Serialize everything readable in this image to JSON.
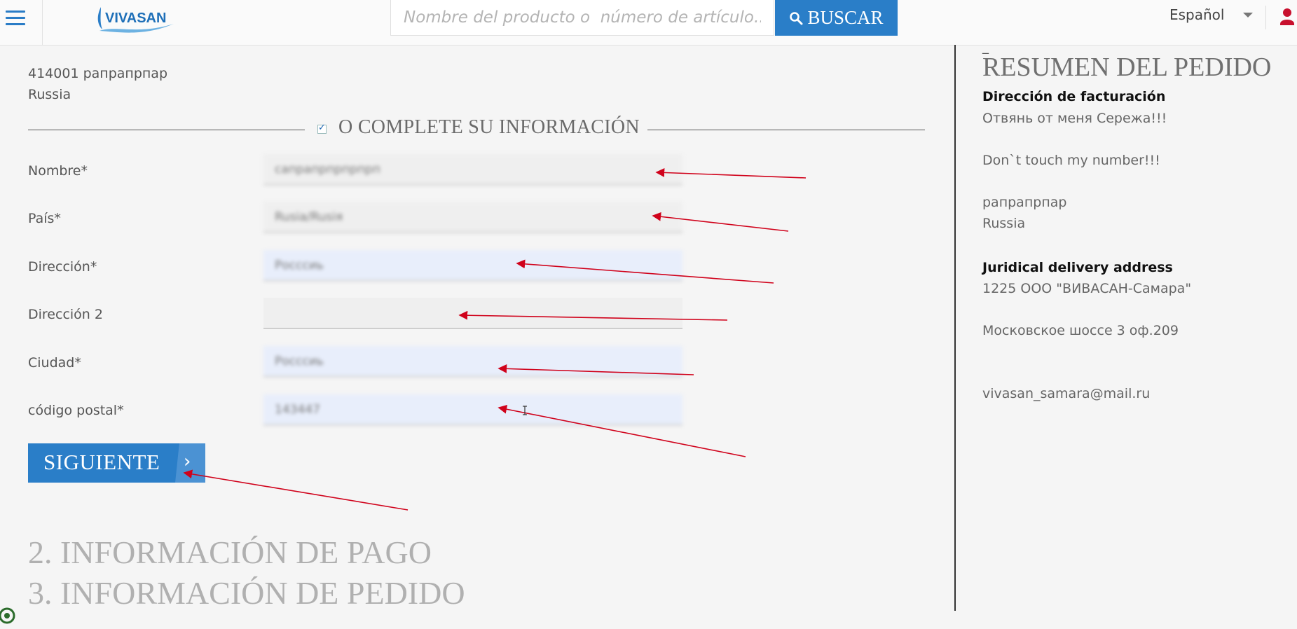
{
  "header": {
    "logo_text": "VIVASAN",
    "search": {
      "placeholder": "Nombre del producto o  número de artículo..",
      "value": ""
    },
    "search_button": "BUSCAR",
    "language": "Español"
  },
  "address": {
    "line1": "414001 рапрапрпар",
    "line2": "Russia"
  },
  "form": {
    "section_title": "O COMPLETE SU INFORMACIÓN",
    "fields": [
      {
        "label": "Nombre*",
        "value": "сапрапрпрпрпрп"
      },
      {
        "label": "País*",
        "value": "Rusia/Rusiя"
      },
      {
        "label": "Dirección*",
        "value": "Росссиь"
      },
      {
        "label": "Dirección 2",
        "value": ""
      },
      {
        "label": "Ciudad*",
        "value": "Росссиь"
      },
      {
        "label": "código postal*",
        "value": "143447"
      }
    ],
    "next_button": "SIGUIENTE",
    "next_arrow": "›"
  },
  "steps": {
    "payment": "2. INFORMACIÓN DE PAGO",
    "order": "3. INFORMACIÓN DE PEDIDO"
  },
  "summary": {
    "dash": "_",
    "title": "RESUMEN DEL PEDIDO",
    "billing": {
      "heading": "Dirección de facturación",
      "lines": [
        "Отвянь от меня Сережа!!!",
        "Don`t touch my number!!!",
        "рапрапрпар",
        "Russia"
      ]
    },
    "delivery": {
      "heading": "Juridical delivery address",
      "lines": [
        "1225 ООО \"ВИВАСАН-Самара\"",
        "Московское шоссе 3 оф.209",
        "vivasan_samara@mail.ru"
      ]
    }
  },
  "colors": {
    "brand_blue": "#2a7ec8",
    "annotation_red": "#d0021b",
    "user_icon": "#c8102e"
  },
  "icons": [
    "hamburger-menu-icon",
    "search-icon",
    "dropdown-caret-icon",
    "user-icon",
    "checkbox-icon",
    "chevron-right-icon",
    "corner-widget-icon"
  ]
}
